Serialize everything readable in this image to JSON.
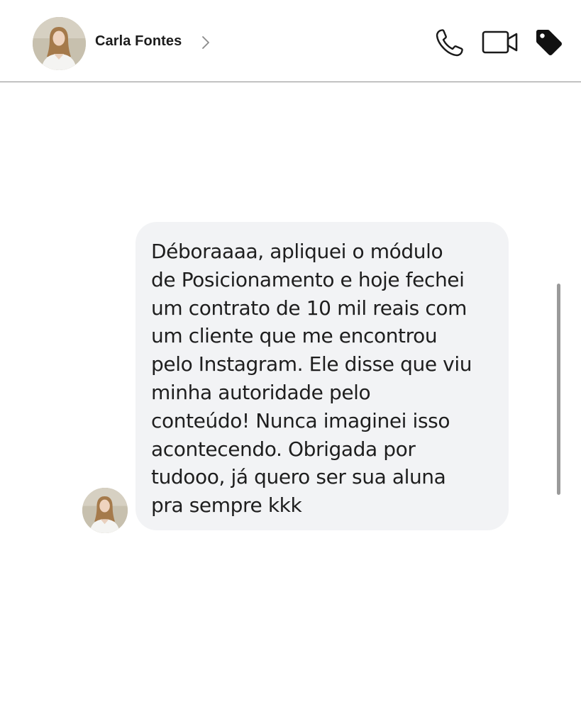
{
  "header": {
    "contact_name": "Carla Fontes",
    "icons": [
      "phone-icon",
      "video-camera-icon",
      "tag-icon",
      "chevron-right-icon"
    ]
  },
  "conversation": {
    "messages": [
      {
        "sender": "Carla Fontes",
        "lines": [
          "Déboraaaa, apliquei o módulo",
          "de Posicionamento e hoje fechei",
          "um contrato de 10 mil reais com",
          "um cliente que me encontrou",
          "pelo Instagram. Ele disse que viu",
          "minha autoridade pelo",
          "conteúdo! Nunca imaginei isso",
          "acontecendo. Obrigada por",
          "tudooo, já quero ser sua aluna",
          "pra sempre kkk"
        ]
      }
    ]
  },
  "colors": {
    "bubble_background": "#f2f3f5",
    "text": "#1e1e1e",
    "header_border": "#8e8e8e",
    "scrollbar": "#9a9a9a"
  }
}
